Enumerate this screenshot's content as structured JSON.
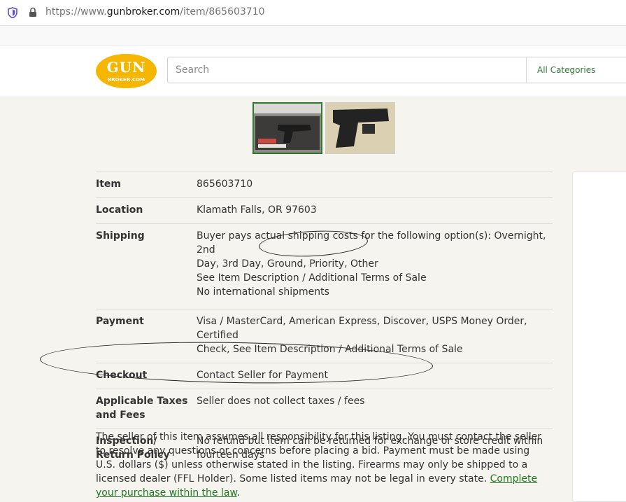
{
  "browser": {
    "url_prefix": "https://www.",
    "url_domain": "gunbroker.com",
    "url_path": "/item/865603710"
  },
  "header": {
    "logo_top": "GUN",
    "logo_bottom": "BROKER.COM",
    "search_placeholder": "Search",
    "category_label": "All Categories"
  },
  "details": [
    {
      "label": "Item",
      "lines": [
        "865603710"
      ]
    },
    {
      "label": "Location",
      "lines": [
        "Klamath Falls, OR 97603"
      ]
    },
    {
      "label": "Shipping",
      "lines": [
        "Buyer pays actual shipping costs for the following option(s): Overnight, 2nd",
        "Day, 3rd Day, Ground, Priority, Other",
        "See Item Description / Additional Terms of Sale",
        "No international shipments"
      ]
    },
    {
      "label": "Payment",
      "lines": [
        "Visa / MasterCard, American Express, Discover, USPS Money Order, Certified",
        "Check, See Item Description / Additional Terms of Sale"
      ]
    },
    {
      "label": "Checkout",
      "lines": [
        "Contact Seller for Payment"
      ]
    },
    {
      "label": "Applicable Taxes and Fees",
      "lines": [
        "Seller does not collect taxes / fees"
      ]
    },
    {
      "label": "Inspection/ Return Policy",
      "lines": [
        "No refund but item can be returned for exchange or store credit within",
        "fourteen days"
      ]
    }
  ],
  "notice": {
    "text": "The seller of this item assumes all responsibility for this listing. You must contact the seller to resolve any questions or concerns before placing a bid. Payment must be made using U.S. dollars ($) unless otherwise stated in the listing. Firearms may only be shipped to a licensed dealer (FFL Holder). Some listed items may not be legal in every state.",
    "link": "Complete your purchase within the law",
    "end": "."
  },
  "colors": {
    "logo_yellow": "#f6b600",
    "link_green": "#1f7a1f",
    "page_bg": "#f5f4ee"
  },
  "icons": [
    "shield-icon",
    "lock-icon"
  ]
}
